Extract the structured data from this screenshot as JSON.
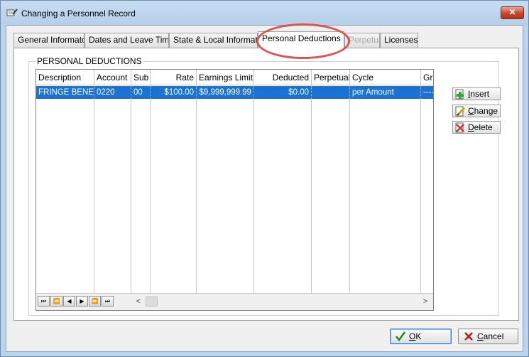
{
  "window": {
    "title": "Changing a Personnel Record",
    "close_glyph": "✕"
  },
  "tabs": [
    {
      "label": "General Informaton",
      "state": "normal"
    },
    {
      "label": "Dates and Leave Time",
      "state": "normal"
    },
    {
      "label": "State & Local Information",
      "state": "normal"
    },
    {
      "label": "Personal Deductions",
      "state": "active"
    },
    {
      "label": "Perpetual",
      "state": "disabled"
    },
    {
      "label": "Licenses",
      "state": "normal"
    }
  ],
  "group": {
    "label": "PERSONAL DEDUCTIONS"
  },
  "grid": {
    "columns": [
      "Description",
      "Account",
      "Sub",
      "Rate",
      "Earnings Limit",
      "Deducted",
      "Perpetual",
      "Cycle",
      "Gro"
    ],
    "rows": [
      [
        "FRINGE BENEF",
        "0220",
        "00",
        "$100.00",
        "$9,999,999.99",
        "$0.00",
        "",
        "per Amount",
        "----"
      ]
    ],
    "selected_row": 0
  },
  "nav": {
    "first": "⏮",
    "prev_page": "⏪",
    "prev": "◀",
    "next": "▶",
    "next_page": "⏩",
    "last": "⏭"
  },
  "scrollbar": {
    "left": "<",
    "right": ">"
  },
  "actions": {
    "insert": {
      "hot": "I",
      "rest": "nsert"
    },
    "change": {
      "hot": "C",
      "rest": "hange"
    },
    "delete": {
      "hot": "D",
      "rest": "elete"
    }
  },
  "dialog": {
    "ok": {
      "hot": "O",
      "rest": "K"
    },
    "cancel": {
      "hot": "C",
      "rest": "ancel"
    }
  },
  "colors": {
    "selection": "#1a73d4",
    "highlight_ring": "#d9534f",
    "title_bg": "#bcd4ea"
  }
}
